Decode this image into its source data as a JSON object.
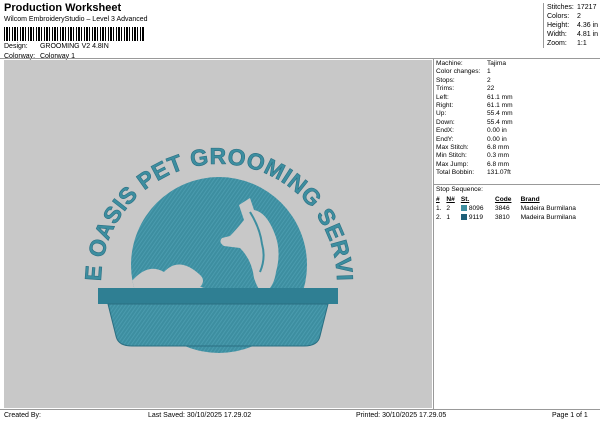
{
  "header": {
    "title": "Production Worksheet",
    "subtitle": "Wilcom EmbroideryStudio – Level 3 Advanced",
    "design_label": "Design:",
    "design_value": "GROOMING V2 4.8IN",
    "colorway_label": "Colorway:",
    "colorway_value": "Colorway 1"
  },
  "stats": [
    {
      "label": "Stitches:",
      "value": "17217"
    },
    {
      "label": "Colors:",
      "value": "2"
    },
    {
      "label": "Height:",
      "value": "4.36 in"
    },
    {
      "label": "Width:",
      "value": "4.81 in"
    },
    {
      "label": "Zoom:",
      "value": "1:1"
    }
  ],
  "info": [
    {
      "label": "Machine:",
      "value": "Tajima"
    },
    {
      "label": "Color changes:",
      "value": "1"
    },
    {
      "label": "Stops:",
      "value": "2"
    },
    {
      "label": "Trims:",
      "value": "22"
    },
    {
      "label": "Left:",
      "value": "61.1 mm"
    },
    {
      "label": "Right:",
      "value": "61.1 mm"
    },
    {
      "label": "Up:",
      "value": "55.4 mm"
    },
    {
      "label": "Down:",
      "value": "55.4 mm"
    },
    {
      "label": "EndX:",
      "value": "0.00 in"
    },
    {
      "label": "EndY:",
      "value": "0.00 in"
    },
    {
      "label": "Max Stitch:",
      "value": "6.8 mm"
    },
    {
      "label": "Min Stitch:",
      "value": "0.3 mm"
    },
    {
      "label": "Max Jump:",
      "value": "6.8 mm"
    },
    {
      "label": "Total Bobbin:",
      "value": "131.07ft"
    }
  ],
  "stop_sequence": {
    "title": "Stop Sequence:",
    "headers": [
      "#",
      "N#",
      "",
      "St.",
      "Code",
      "Brand"
    ],
    "rows": [
      {
        "num": "1.",
        "n": "2",
        "color": "#3f8fa0",
        "st": "8096",
        "code": "3846",
        "brand": "Madeira Burmilana"
      },
      {
        "num": "2.",
        "n": "1",
        "color": "#1e5f77",
        "st": "9119",
        "code": "3810",
        "brand": "Madeira Burmilana"
      }
    ]
  },
  "logo": {
    "arc_text": "BLUE OASIS PET GROOMING SERVICES"
  },
  "colors": {
    "thread_main": "#3d8ea0",
    "thread_dark": "#2a6f82",
    "canvas_bg": "#c8c8c8"
  },
  "footer": {
    "created_by": "Created By:",
    "last_saved": "Last Saved: 30/10/2025 17.29.02",
    "printed": "Printed: 30/10/2025 17.29.05",
    "page": "Page 1 of 1"
  }
}
